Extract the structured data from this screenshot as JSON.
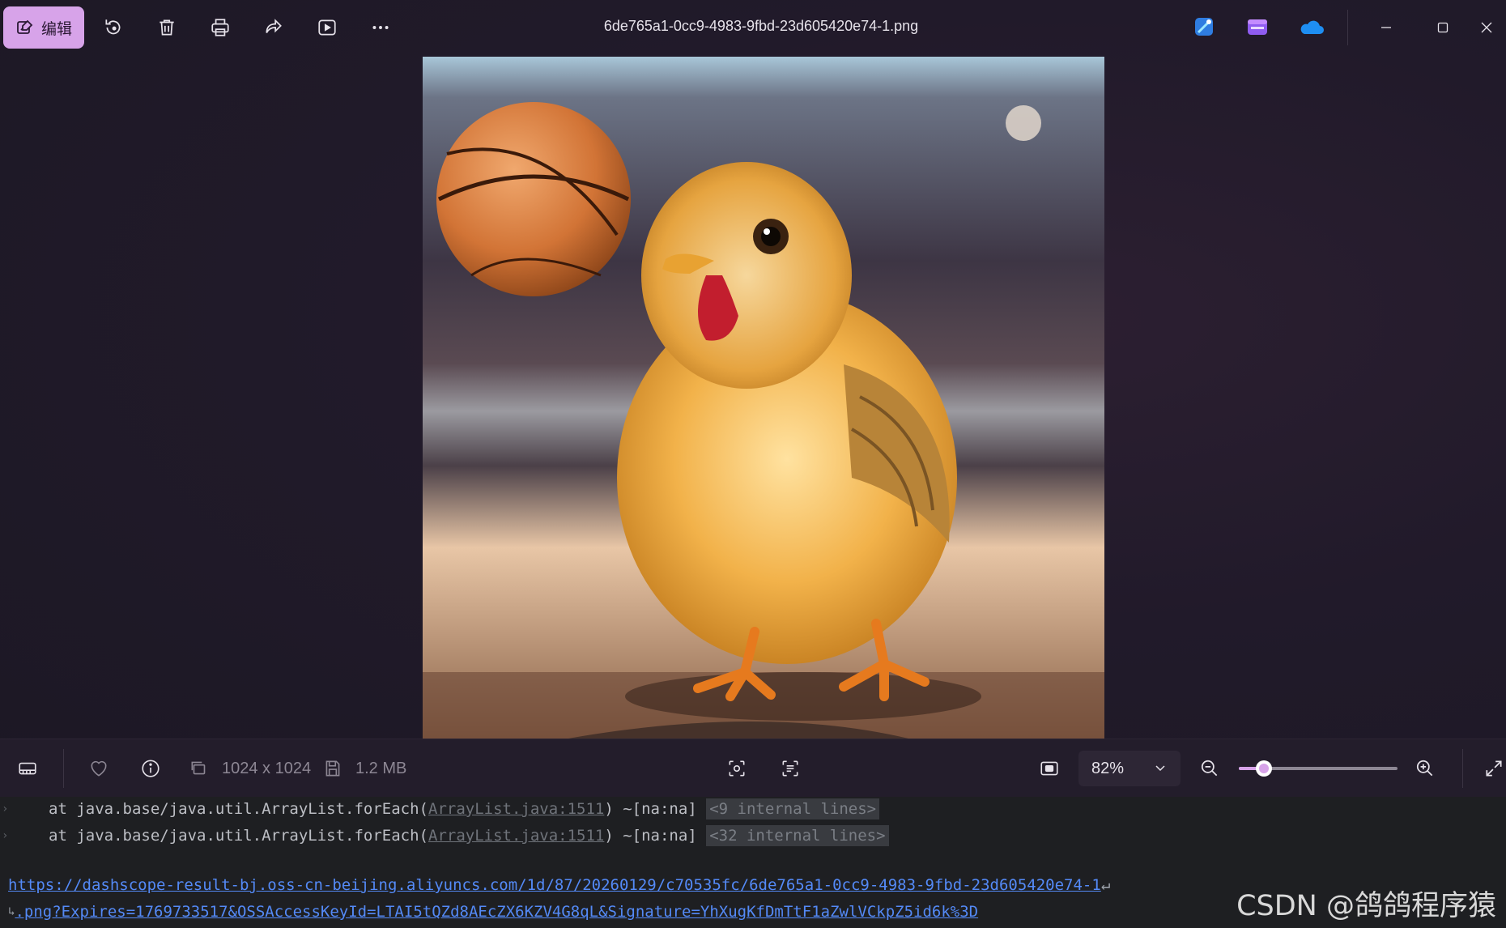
{
  "window": {
    "file_name": "6de765a1-0cc9-4983-9fbd-23d605420e74-1.png"
  },
  "toolbar": {
    "edit_label": "编辑",
    "accent_color": "#d7a3e9"
  },
  "image_info": {
    "dimensions": "1024 x 1024",
    "file_size": "1.2 MB"
  },
  "zoom": {
    "label": "82%",
    "level": 0.16
  },
  "console": {
    "lines": [
      {
        "prefix": "at java.base/java.util.ArrayList.forEach(",
        "link": "ArrayList.java:1511",
        "suffix": ") ~[na:na] ",
        "internal": "<9 internal lines>"
      },
      {
        "prefix": "at java.base/java.util.ArrayList.forEach(",
        "link": "ArrayList.java:1511",
        "suffix": ") ~[na:na] ",
        "internal": "<32 internal lines>"
      }
    ],
    "url_line_1": "https://dashscope-result-bj.oss-cn-beijing.aliyuncs.com/1d/87/20260129/c70535fc/6de765a1-0cc9-4983-9fbd-23d605420e74-1",
    "url_line_2": ".png?Expires=1769733517&OSSAccessKeyId=LTAI5tQZd8AEcZX6KZV4G8qL&Signature=YhXugKfDmTtF1aZwlVCkpZ5id6k%3D"
  },
  "watermark": "CSDN @鸽鸽程序猿"
}
